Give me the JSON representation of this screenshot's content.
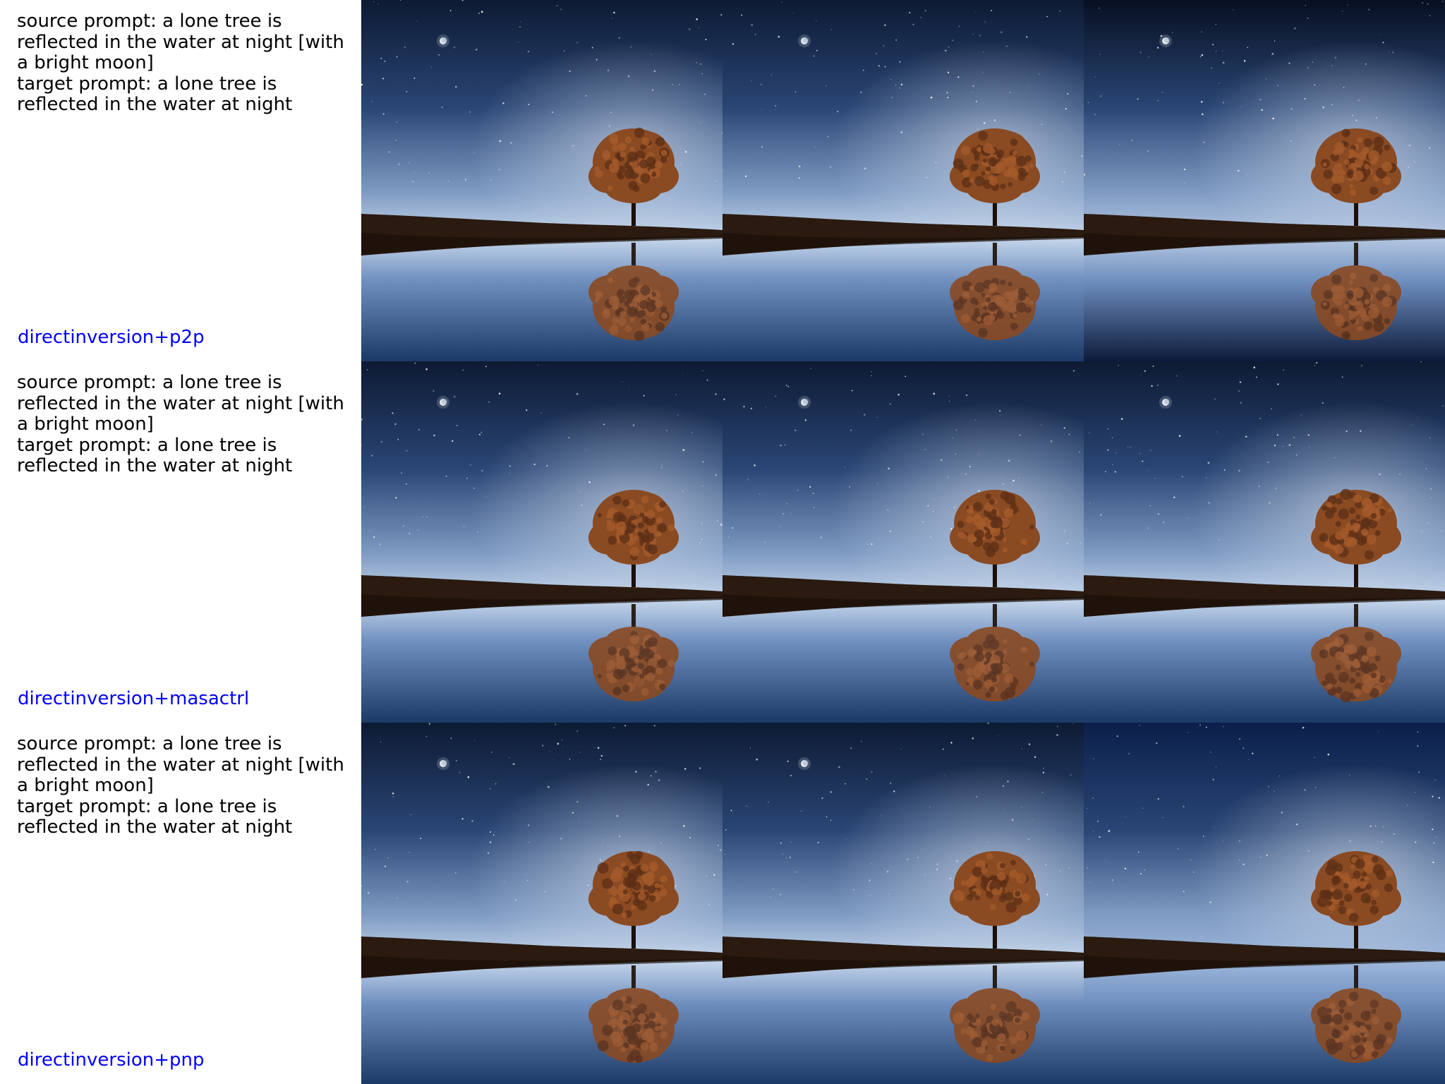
{
  "rows": [
    {
      "source_prompt": "source prompt: a lone tree is reflected in the water at night [with a bright moon]",
      "target_prompt": "target prompt: a lone tree is reflected in the water at night",
      "method": "directinversion+p2p",
      "method_color": "#0000ff"
    },
    {
      "source_prompt": "source prompt: a lone tree is reflected in the water at night [with a bright moon]",
      "target_prompt": "target prompt: a lone tree is reflected in the water at night",
      "method": "directinversion+masactrl",
      "method_color": "#0000ff"
    },
    {
      "source_prompt": "source prompt: a lone tree is reflected in the water at night [with a bright moon]",
      "target_prompt": "target prompt: a lone tree is reflected in the water at night",
      "method": "directinversion+pnp",
      "method_color": "#0000ff"
    }
  ],
  "image_variants": [
    [
      "moon",
      "moon",
      "moon-dark"
    ],
    [
      "moon",
      "moon",
      "moon"
    ],
    [
      "moon",
      "moon",
      "no-moon"
    ]
  ],
  "colors": {
    "sky_top": "#0d1a33",
    "sky_horizon": "#c8d8ec",
    "foliage": "#8a4a22",
    "ground": "#2a1a10",
    "water": "#1c3a66"
  }
}
